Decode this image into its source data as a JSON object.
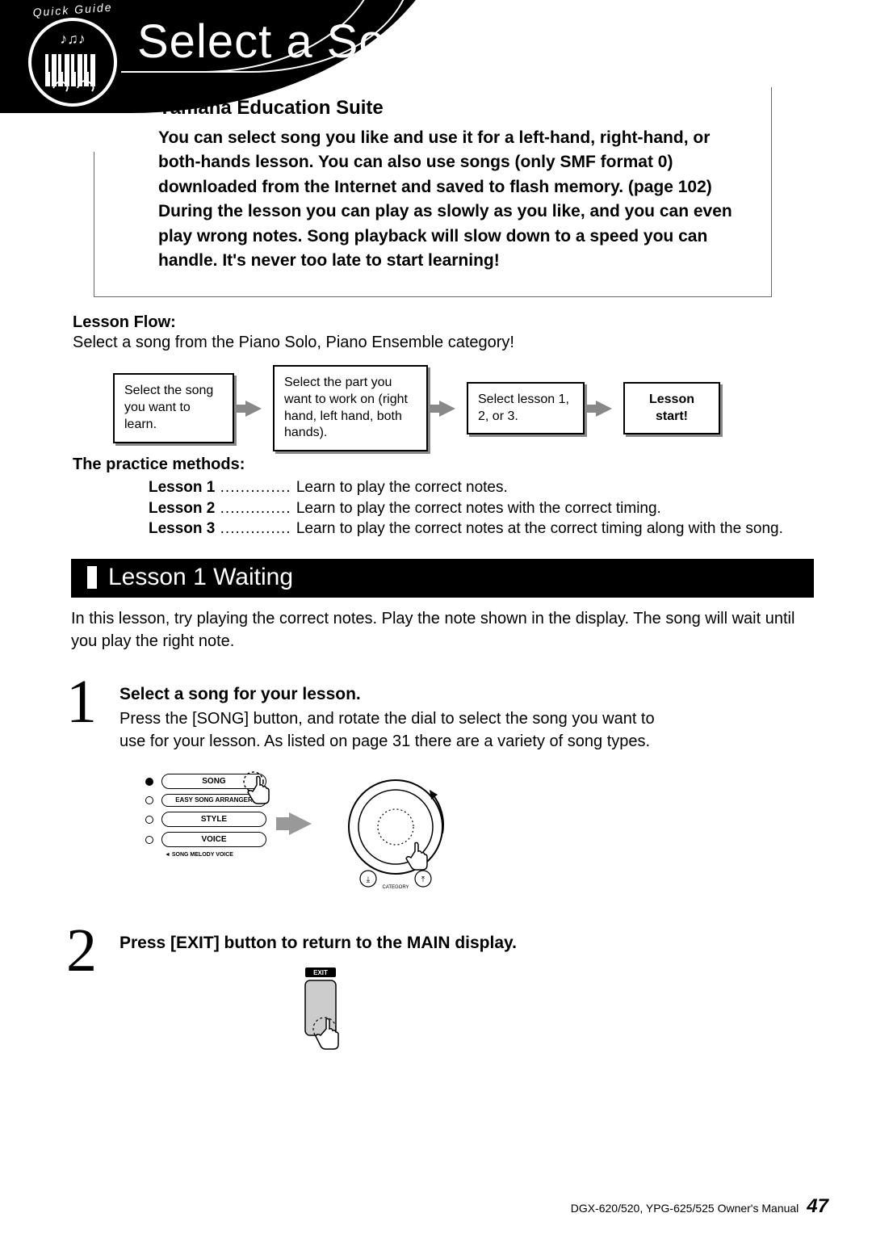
{
  "header": {
    "quick_guide": "Quick Guide",
    "title": "Select a Song"
  },
  "intro": {
    "heading": "Yamaha Education Suite",
    "body": "You can select song you like and use it for a left-hand, right-hand, or both-hands lesson. You can also use songs (only SMF format 0) downloaded from the Internet and saved to flash memory. (page 102) During the lesson you can play as slowly as you like, and you can even play wrong notes. Song playback will slow down to a speed you can handle. It's never too late to start learning!"
  },
  "lesson_flow": {
    "heading": "Lesson Flow:",
    "subtitle": "Select a song from the Piano Solo, Piano Ensemble category!",
    "boxes": [
      "Select the song you want to learn.",
      "Select the part you want to work on (right hand, left hand, both hands).",
      "Select lesson 1, 2, or 3.",
      "Lesson start!"
    ]
  },
  "practice": {
    "heading": "The practice methods:",
    "items": [
      {
        "label": "Lesson 1",
        "desc": "Learn to play the correct notes."
      },
      {
        "label": "Lesson 2",
        "desc": "Learn to play the correct notes with the correct timing."
      },
      {
        "label": "Lesson 3",
        "desc": "Learn to play the correct notes at the correct timing along with the song."
      }
    ]
  },
  "bar_heading": "Lesson 1 Waiting",
  "lesson1_intro": "In this lesson, try playing the correct notes. Play the note shown in the display. The song will wait until you play the right note.",
  "steps": {
    "s1": {
      "num": "1",
      "heading": "Select a song for your lesson.",
      "body": "Press the [SONG] button, and rotate the dial to select the song you want to use for your lesson. As listed on page 31 there are a variety of song types."
    },
    "s2": {
      "num": "2",
      "heading": "Press [EXIT] button to return to the MAIN display."
    }
  },
  "panel": {
    "buttons": [
      "SONG",
      "EASY SONG ARRANGER",
      "STYLE",
      "VOICE"
    ],
    "melody_label": "SONG MELODY VOICE",
    "category_label": "CATEGORY",
    "exit_label": "EXIT"
  },
  "footer": {
    "manual": "DGX-620/520, YPG-625/525  Owner's Manual",
    "page": "47"
  }
}
